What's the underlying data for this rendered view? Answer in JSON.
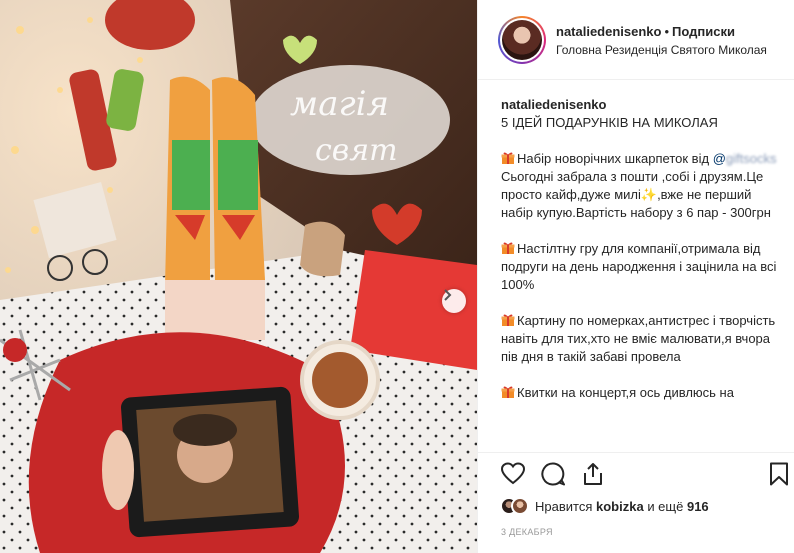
{
  "post": {
    "username": "nataliedenisenko",
    "separator": "•",
    "follow_label": "Подписки",
    "location": "Головна Резиденція Святого Миколая"
  },
  "caption": {
    "username": "nataliedenisenko",
    "title": "5 ІДЕЙ ПОДАРУНКІВ НА МИКОЛАЯ",
    "item1_text": "Набір новорічних шкарпеток від",
    "item1_mention_at": "@",
    "item1_mention_blurred": "giftsocks",
    "item1_body_a": "Сьогодні забрала з пошти ,собі і друзям.Це просто кайф,дуже милі",
    "item1_emoji": "✨",
    "item1_body_b": ",вже не перший набір купую.Вартість набору з 6 пар - 300грн",
    "item2_text": "Настілтну гру для компанії,отримала від подруги на день народження і зацінила на всі 100%",
    "item3_text": "Картину по номерках,антистрес і творчість навіть для тих,хто не вміє малювати,я вчора пів дня в такій забаві провела",
    "item4_text": "Квитки на концерт,я ось дивлюсь на"
  },
  "likes": {
    "prefix": "Нравится",
    "user": "kobizka",
    "mid": "и ещё",
    "count": "916"
  },
  "date": "3 ДЕКАБРЯ",
  "icons": {
    "gift": "gift-icon",
    "next": "chevron-right-icon",
    "like": "heart-icon",
    "comment": "comment-icon",
    "share": "share-icon",
    "save": "bookmark-icon"
  }
}
